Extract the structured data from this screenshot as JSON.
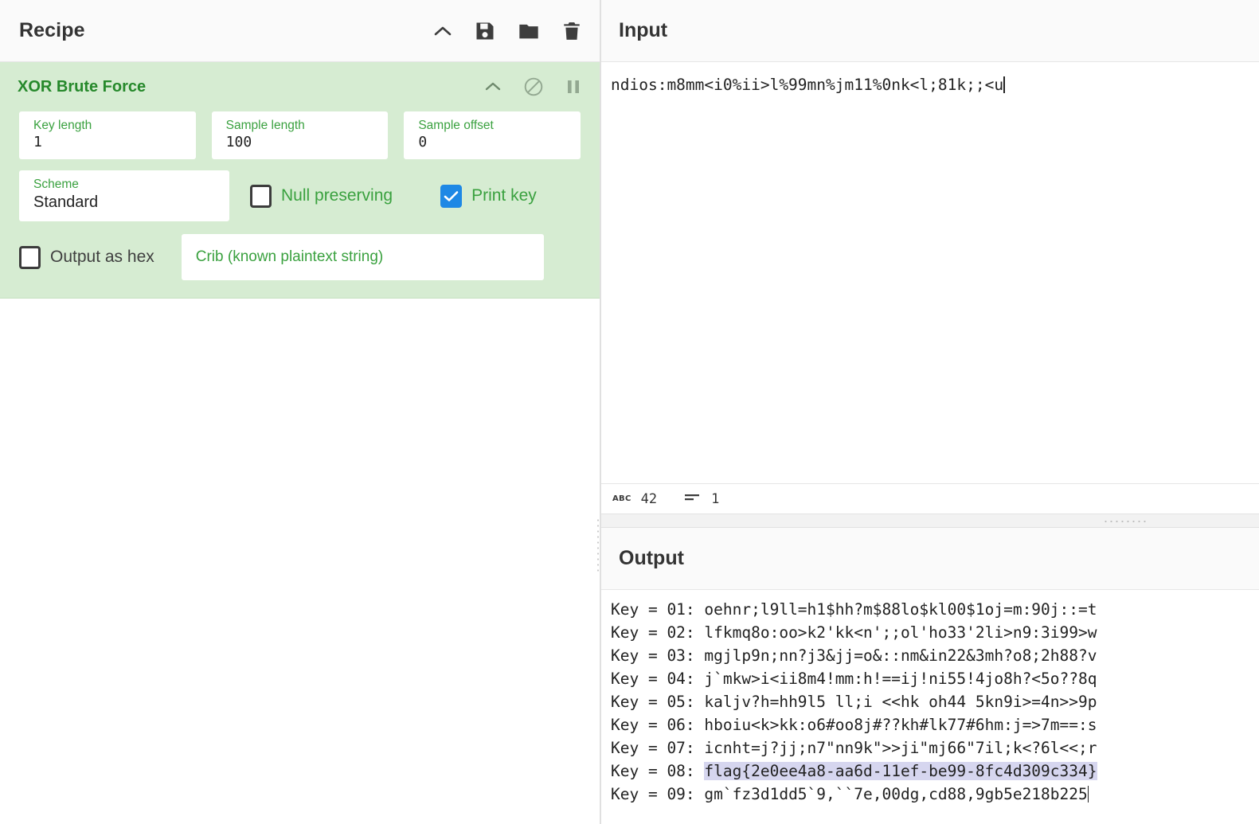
{
  "recipe": {
    "title": "Recipe",
    "title_icons": [
      {
        "name": "collapse-chevron-icon",
        "glyph": "chevron-up"
      },
      {
        "name": "save-recipe-icon",
        "glyph": "floppy-disk"
      },
      {
        "name": "load-recipe-icon",
        "glyph": "folder"
      },
      {
        "name": "clear-recipe-icon",
        "glyph": "trash"
      }
    ],
    "operation": {
      "name": "XOR Brute Force",
      "icons": [
        {
          "name": "op-collapse-icon",
          "glyph": "chevron-up"
        },
        {
          "name": "op-disable-icon",
          "glyph": "no-entry"
        },
        {
          "name": "op-breakpoint-icon",
          "glyph": "pause"
        }
      ],
      "args": {
        "key_length": {
          "label": "Key length",
          "value": "1"
        },
        "sample_length": {
          "label": "Sample length",
          "value": "100"
        },
        "sample_offset": {
          "label": "Sample offset",
          "value": "0"
        },
        "scheme": {
          "label": "Scheme",
          "value": "Standard"
        },
        "null_preserving": {
          "label": "Null preserving",
          "checked": false
        },
        "print_key": {
          "label": "Print key",
          "checked": true
        },
        "output_as_hex": {
          "label": "Output as hex",
          "checked": false
        },
        "crib": {
          "placeholder": "Crib (known plaintext string)",
          "value": ""
        }
      }
    }
  },
  "input": {
    "title": "Input",
    "value": "ndios:m8mm<i0%ii>l%99mn%jm11%0nk<l;81k;;<u",
    "status": {
      "length_icon": "abc-icon",
      "length": "42",
      "lines_icon": "lines-icon",
      "lines": "1"
    }
  },
  "output": {
    "title": "Output",
    "lines": [
      {
        "label": "Key = 01: ",
        "text": "oehnr;l9ll=h1$hh?m$88lo$kl00$1oj=m:90j::=t",
        "highlight": false
      },
      {
        "label": "Key = 02: ",
        "text": "lfkmq8o:oo>k2'kk<n';;ol'ho33'2li>n9:3i99>w",
        "highlight": false
      },
      {
        "label": "Key = 03: ",
        "text": "mgjlp9n;nn?j3&jj=o&::nm&in22&3mh?o8;2h88?v",
        "highlight": false
      },
      {
        "label": "Key = 04: ",
        "text": "j`mkw>i<ii8m4!mm:h!==ij!ni55!4jo8h?<5o??8q",
        "highlight": false
      },
      {
        "label": "Key = 05: ",
        "text": "kaljv?h=hh9l5 ll;i <<hk oh44 5kn9i>=4n>>9p",
        "highlight": false
      },
      {
        "label": "Key = 06: ",
        "text": "hboiu<k>kk:o6#oo8j#??kh#lk77#6hm:j=>7m==:s",
        "highlight": false
      },
      {
        "label": "Key = 07: ",
        "text": "icnht=j?jj;n7\"nn9k\">>ji\"mj66\"7il;k<?6l<<;r",
        "highlight": false
      },
      {
        "label": "Key = 08: ",
        "text": "flag{2e0ee4a8-aa6d-11ef-be99-8fc4d309c334}",
        "highlight": true
      },
      {
        "label": "Key = 09: ",
        "text": "gm`fz3d1dd5`9,``7e,00dg,cd88,9gb5e218b225",
        "highlight": false
      }
    ]
  },
  "colors": {
    "op_background": "#d6ecd2",
    "op_accent": "#26892b",
    "arg_label": "#3aa13f",
    "checkbox_checked": "#1e88e5",
    "highlight": "#d6d6ef"
  }
}
